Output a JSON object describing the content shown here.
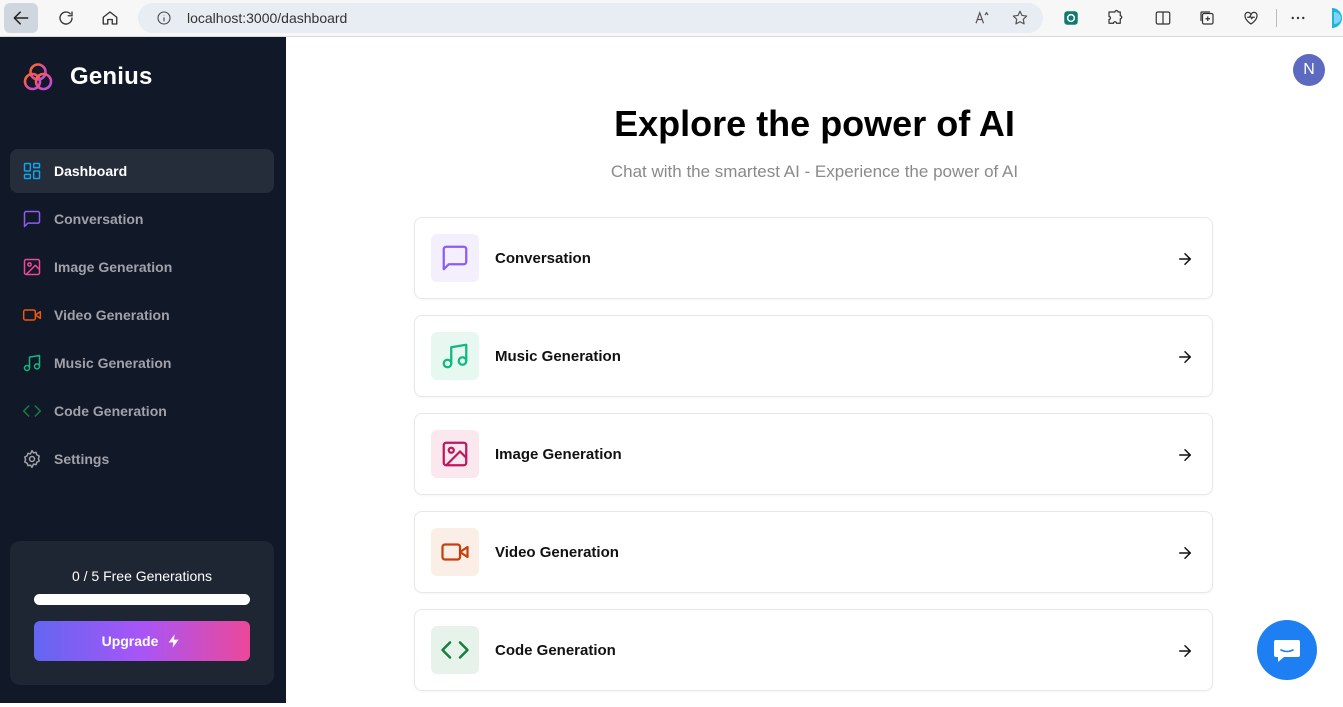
{
  "browser": {
    "url": "localhost:3000/dashboard"
  },
  "sidebar": {
    "brand": "Genius",
    "items": [
      {
        "label": "Dashboard",
        "icon": "layout-dashboard-icon",
        "color": "#0ea5e9"
      },
      {
        "label": "Conversation",
        "icon": "message-square-icon",
        "color": "#8b5cf6"
      },
      {
        "label": "Image Generation",
        "icon": "image-icon",
        "color": "#ec4899"
      },
      {
        "label": "Video Generation",
        "icon": "video-icon",
        "color": "#ea580c"
      },
      {
        "label": "Music Generation",
        "icon": "music-icon",
        "color": "#10b981"
      },
      {
        "label": "Code Generation",
        "icon": "code-icon",
        "color": "#15803d"
      },
      {
        "label": "Settings",
        "icon": "settings-icon",
        "color": "#a1a1aa"
      }
    ],
    "free": {
      "text": "0 / 5 Free Generations",
      "used": 0,
      "limit": 5,
      "upgrade_label": "Upgrade"
    }
  },
  "header": {
    "avatar_initial": "N"
  },
  "main": {
    "title": "Explore the power of AI",
    "subtitle": "Chat with the smartest AI - Experience the power of AI",
    "tools": [
      {
        "label": "Conversation",
        "icon": "message-square-icon",
        "color": "#8b5cf6",
        "bg": "#f3effd"
      },
      {
        "label": "Music Generation",
        "icon": "music-icon",
        "color": "#10b981",
        "bg": "#e7f8f1"
      },
      {
        "label": "Image Generation",
        "icon": "image-icon",
        "color": "#be185d",
        "bg": "#fbe8ef"
      },
      {
        "label": "Video Generation",
        "icon": "video-icon",
        "color": "#c2410c",
        "bg": "#fbeee6"
      },
      {
        "label": "Code Generation",
        "icon": "code-icon",
        "color": "#15803d",
        "bg": "#e7f3ea"
      }
    ]
  },
  "widgets": {
    "chat_icon": "chat-bubble-icon"
  }
}
